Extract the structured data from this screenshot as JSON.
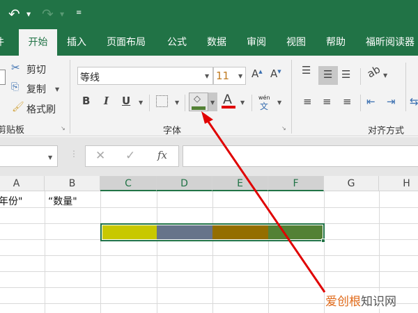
{
  "quick_access": {
    "undo_icon": "undo-icon",
    "redo_icon": "redo-icon",
    "customize_icon": "customize-icon"
  },
  "tabs": [
    {
      "label": "件"
    },
    {
      "label": "开始"
    },
    {
      "label": "插入"
    },
    {
      "label": "页面布局"
    },
    {
      "label": "公式"
    },
    {
      "label": "数据"
    },
    {
      "label": "审阅"
    },
    {
      "label": "视图"
    },
    {
      "label": "帮助"
    },
    {
      "label": "福昕阅读器"
    }
  ],
  "clipboard": {
    "cut": "剪切",
    "copy": "复制",
    "format_painter": "格式刷",
    "group": "剪贴板"
  },
  "font": {
    "name": "等线",
    "size": "11",
    "bold": "B",
    "italic": "I",
    "underline": "U",
    "font_color_glyph": "A",
    "phonetic_top": "wén",
    "phonetic_bottom": "文",
    "group": "字体",
    "fill_color": "#538135",
    "font_color": "#e00000"
  },
  "alignment": {
    "group": "对齐方式"
  },
  "formula_bar": {
    "cancel": "✕",
    "enter": "✓",
    "fx": "fx",
    "value": ""
  },
  "columns": [
    "A",
    "B",
    "C",
    "D",
    "E",
    "F",
    "G",
    "H"
  ],
  "cells": {
    "A1": "年份\"",
    "B1": "“数量\""
  },
  "fill_colors": {
    "C3": "#c8c800",
    "D3": "#66748a",
    "E3": "#946e00",
    "F3": "#538135"
  },
  "watermark": {
    "part1": "爱创根",
    "part2": "知识网"
  },
  "accent": "#217346"
}
